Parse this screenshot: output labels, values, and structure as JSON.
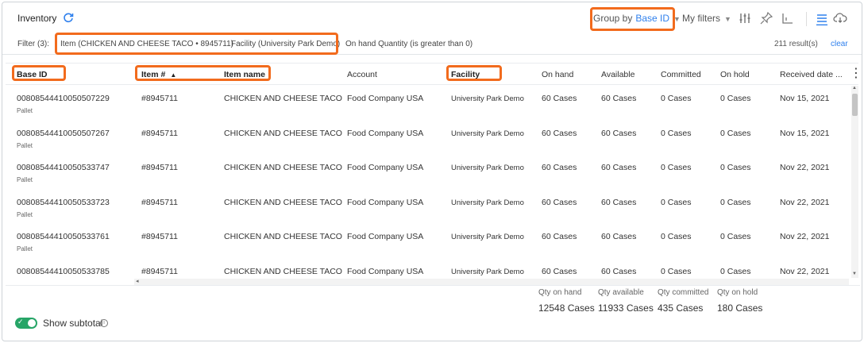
{
  "header": {
    "title": "Inventory",
    "group_by_label": "Group by",
    "group_by_value": "Base ID",
    "my_filters_label": "My filters"
  },
  "filters": {
    "label": "Filter (3):",
    "item": "Item (CHICKEN AND CHEESE TACO • 8945711)",
    "facility": "Facility (University Park Demo)",
    "onhand": "On hand Quantity (is greater than 0)",
    "result_count": "211 result(s)",
    "clear": "clear"
  },
  "columns": {
    "base_id": "Base ID",
    "item_no": "Item #",
    "item_name": "Item name",
    "account": "Account",
    "facility": "Facility",
    "on_hand": "On hand",
    "available": "Available",
    "committed": "Committed",
    "on_hold": "On hold",
    "received": "Received date ..."
  },
  "rows": [
    {
      "base_id": "00808544410050507229",
      "type": "Pallet",
      "item_no": "#8945711",
      "item_name": "CHICKEN AND CHEESE TACO",
      "account": "Food Company USA",
      "facility": "University Park Demo",
      "on_hand": "60 Cases",
      "available": "60 Cases",
      "committed": "0 Cases",
      "on_hold": "0 Cases",
      "received": "Nov 15, 2021"
    },
    {
      "base_id": "00808544410050507267",
      "type": "Pallet",
      "item_no": "#8945711",
      "item_name": "CHICKEN AND CHEESE TACO",
      "account": "Food Company USA",
      "facility": "University Park Demo",
      "on_hand": "60 Cases",
      "available": "60 Cases",
      "committed": "0 Cases",
      "on_hold": "0 Cases",
      "received": "Nov 15, 2021"
    },
    {
      "base_id": "00808544410050533747",
      "type": "Pallet",
      "item_no": "#8945711",
      "item_name": "CHICKEN AND CHEESE TACO",
      "account": "Food Company USA",
      "facility": "University Park Demo",
      "on_hand": "60 Cases",
      "available": "60 Cases",
      "committed": "0 Cases",
      "on_hold": "0 Cases",
      "received": "Nov 22, 2021"
    },
    {
      "base_id": "00808544410050533723",
      "type": "Pallet",
      "item_no": "#8945711",
      "item_name": "CHICKEN AND CHEESE TACO",
      "account": "Food Company USA",
      "facility": "University Park Demo",
      "on_hand": "60 Cases",
      "available": "60 Cases",
      "committed": "0 Cases",
      "on_hold": "0 Cases",
      "received": "Nov 22, 2021"
    },
    {
      "base_id": "00808544410050533761",
      "type": "Pallet",
      "item_no": "#8945711",
      "item_name": "CHICKEN AND CHEESE TACO",
      "account": "Food Company USA",
      "facility": "University Park Demo",
      "on_hand": "60 Cases",
      "available": "60 Cases",
      "committed": "0 Cases",
      "on_hold": "0 Cases",
      "received": "Nov 22, 2021"
    },
    {
      "base_id": "00808544410050533785",
      "type": "",
      "item_no": "#8945711",
      "item_name": "CHICKEN AND CHEESE TACO",
      "account": "Food Company USA",
      "facility": "University Park Demo",
      "on_hand": "60 Cases",
      "available": "60 Cases",
      "committed": "0 Cases",
      "on_hold": "0 Cases",
      "received": "Nov 22, 2021"
    }
  ],
  "summary": {
    "qty_on_hand_label": "Qty on hand",
    "qty_on_hand": "12548 Cases",
    "qty_available_label": "Qty available",
    "qty_available": "11933 Cases",
    "qty_committed_label": "Qty committed",
    "qty_committed": "435 Cases",
    "qty_on_hold_label": "Qty on hold",
    "qty_on_hold": "180 Cases"
  },
  "footer": {
    "show_subtotal": "Show subtotal"
  },
  "colors": {
    "accent": "#2f80ed",
    "highlight": "#f26b1d",
    "toggle_on": "#27a567"
  },
  "icons": [
    "refresh-icon",
    "chevron-down-icon",
    "column-settings-icon",
    "pin-icon",
    "chart-icon",
    "list-view-icon",
    "cloud-download-icon",
    "sort-asc-icon",
    "kebab-menu-icon",
    "info-icon"
  ]
}
